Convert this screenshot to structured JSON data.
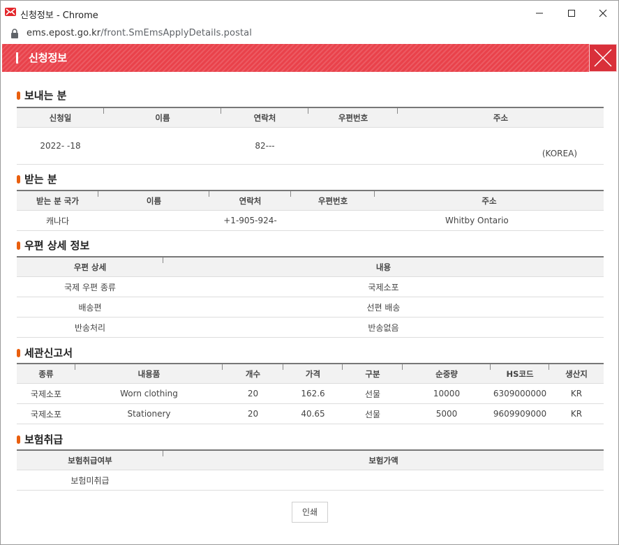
{
  "window": {
    "title": "신청정보 - Chrome",
    "url_host": "ems.epost.go.kr",
    "url_path": "/front.SmEmsApplyDetails.postal"
  },
  "header": {
    "title": "신청정보"
  },
  "sender": {
    "title": "보내는 분",
    "headers": [
      "신청일",
      "이름",
      "연락처",
      "우편번호",
      "주소"
    ],
    "row": [
      "2022-  -18",
      "",
      "82---",
      "",
      "(KOREA)"
    ]
  },
  "receiver": {
    "title": "받는 분",
    "headers": [
      "받는 분 국가",
      "이름",
      "연락처",
      "우편번호",
      "주소"
    ],
    "row": [
      "캐나다",
      "",
      "+1-905-924-",
      "",
      "Whitby Ontario"
    ]
  },
  "postal_detail": {
    "title": "우편 상세 정보",
    "headers": [
      "우편 상세",
      "내용"
    ],
    "rows": [
      [
        "국제 우편 종류",
        "국제소포"
      ],
      [
        "배송편",
        "선편 배송"
      ],
      [
        "반송처리",
        "반송없음"
      ]
    ]
  },
  "customs": {
    "title": "세관신고서",
    "headers": [
      "종류",
      "내용품",
      "개수",
      "가격",
      "구분",
      "순중량",
      "HS코드",
      "생산지"
    ],
    "rows": [
      [
        "국제소포",
        "Worn clothing",
        "20",
        "162.6",
        "선물",
        "10000",
        "6309000000",
        "KR"
      ],
      [
        "국제소포",
        "Stationery",
        "20",
        "40.65",
        "선물",
        "5000",
        "9609909000",
        "KR"
      ]
    ]
  },
  "insurance": {
    "title": "보험취급",
    "headers": [
      "보험취급여부",
      "보험가액"
    ],
    "row": [
      "보험미취급",
      ""
    ]
  },
  "print_button": "인쇄",
  "colors": {
    "header_red": "#e9424b",
    "bullet_orange": "#e95f0e"
  },
  "icons": [
    "epost-logo-icon",
    "minimize-icon",
    "maximize-icon",
    "close-icon",
    "lock-icon",
    "header-close-icon"
  ]
}
